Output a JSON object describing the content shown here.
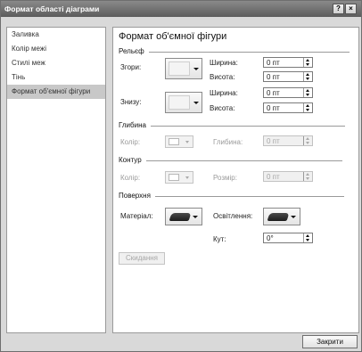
{
  "window": {
    "title": "Формат області діаграми",
    "help_label": "?",
    "close_label": "×"
  },
  "nav": {
    "items": [
      {
        "label": "Заливка",
        "selected": false
      },
      {
        "label": "Колір межі",
        "selected": false
      },
      {
        "label": "Стилі меж",
        "selected": false
      },
      {
        "label": "Тінь",
        "selected": false
      },
      {
        "label": "Формат об'ємної фігури",
        "selected": true
      }
    ]
  },
  "panel": {
    "title": "Формат об'ємної фігури",
    "relief": {
      "section_label": "Рельєф",
      "top_label": "Згори:",
      "bottom_label": "Знизу:",
      "width_label": "Ширина:",
      "height_label": "Висота:",
      "top_width": "0 пт",
      "top_height": "0 пт",
      "bottom_width": "0 пт",
      "bottom_height": "0 пт"
    },
    "depth": {
      "section_label": "Глибина",
      "color_label": "Колір:",
      "depth_label": "Глибина:",
      "depth_value": "0 пт"
    },
    "contour": {
      "section_label": "Контур",
      "color_label": "Колір:",
      "size_label": "Розмір:",
      "size_value": "0 пт"
    },
    "surface": {
      "section_label": "Поверхня",
      "material_label": "Матеріал:",
      "lighting_label": "Освітлення:",
      "angle_label": "Кут:",
      "angle_value": "0°"
    },
    "reset_label": "Скидання"
  },
  "footer": {
    "close_label": "Закрити"
  }
}
